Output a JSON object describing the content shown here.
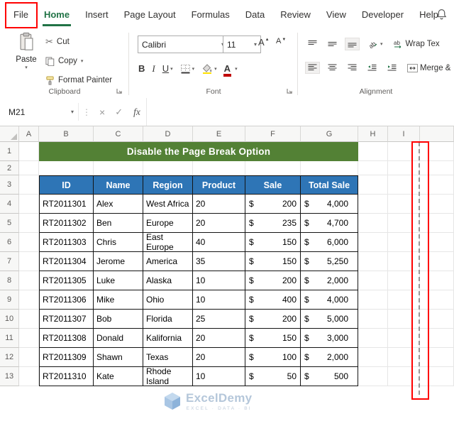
{
  "colors": {
    "accent_green": "#217346",
    "banner_green": "#538135",
    "table_header_blue": "#2E75B6",
    "annotation_red": "#FF0000"
  },
  "icons": {
    "cut": "✂",
    "dropdown": "▾",
    "cancel": "×",
    "enter": "✓",
    "separator": "⋮",
    "increase_letter": "A",
    "decrease_letter": "A",
    "up_tiny": "▲",
    "down_tiny": "▼"
  },
  "ribbon": {
    "tabs": [
      {
        "label": "File"
      },
      {
        "label": "Home"
      },
      {
        "label": "Insert"
      },
      {
        "label": "Page Layout"
      },
      {
        "label": "Formulas"
      },
      {
        "label": "Data"
      },
      {
        "label": "Review"
      },
      {
        "label": "View"
      },
      {
        "label": "Developer"
      },
      {
        "label": "Help"
      }
    ],
    "active_tab": "Home",
    "highlighted_tab": "File",
    "clipboard": {
      "group_label": "Clipboard",
      "paste": "Paste",
      "cut": "Cut",
      "copy": "Copy",
      "format_painter": "Format Painter"
    },
    "font": {
      "group_label": "Font",
      "font_name": "Calibri",
      "font_size": "11",
      "bold": "B",
      "italic": "I",
      "underline": "U",
      "font_color_letter": "A"
    },
    "alignment": {
      "group_label": "Alignment",
      "orientation_ab": "ab",
      "wrap_ab": "ab",
      "wrap_text": "Wrap Tex",
      "merge": "Merge &"
    }
  },
  "formula_bar": {
    "name_box": "M21",
    "fx_label": "fx",
    "formula_value": ""
  },
  "grid": {
    "column_headers": [
      "A",
      "B",
      "C",
      "D",
      "E",
      "F",
      "G",
      "H",
      "I"
    ],
    "row_headers": [
      "1",
      "2",
      "3",
      "4",
      "5",
      "6",
      "7",
      "8",
      "9",
      "10",
      "11",
      "12",
      "13"
    ],
    "banner_text": "Disable the Page Break Option",
    "table_headers": [
      "ID",
      "Name",
      "Region",
      "Product",
      "Sale",
      "Total Sale"
    ],
    "table_rows": [
      {
        "id": "RT2011301",
        "name": "Alex",
        "region": "West Africa",
        "product": "20",
        "sale_cur": "$",
        "sale": "200",
        "total_cur": "$",
        "total": "4,000"
      },
      {
        "id": "RT2011302",
        "name": "Ben",
        "region": "Europe",
        "product": "20",
        "sale_cur": "$",
        "sale": "235",
        "total_cur": "$",
        "total": "4,700"
      },
      {
        "id": "RT2011303",
        "name": "Chris",
        "region": "East Europe",
        "product": "40",
        "sale_cur": "$",
        "sale": "150",
        "total_cur": "$",
        "total": "6,000"
      },
      {
        "id": "RT2011304",
        "name": "Jerome",
        "region": "America",
        "product": "35",
        "sale_cur": "$",
        "sale": "150",
        "total_cur": "$",
        "total": "5,250"
      },
      {
        "id": "RT2011305",
        "name": "Luke",
        "region": "Alaska",
        "product": "10",
        "sale_cur": "$",
        "sale": "200",
        "total_cur": "$",
        "total": "2,000"
      },
      {
        "id": "RT2011306",
        "name": "Mike",
        "region": "Ohio",
        "product": "10",
        "sale_cur": "$",
        "sale": "400",
        "total_cur": "$",
        "total": "4,000"
      },
      {
        "id": "RT2011307",
        "name": "Bob",
        "region": "Florida",
        "product": "25",
        "sale_cur": "$",
        "sale": "200",
        "total_cur": "$",
        "total": "5,000"
      },
      {
        "id": "RT2011308",
        "name": "Donald",
        "region": "Kalifornia",
        "product": "20",
        "sale_cur": "$",
        "sale": "150",
        "total_cur": "$",
        "total": "3,000"
      },
      {
        "id": "RT2011309",
        "name": "Shawn",
        "region": "Texas",
        "product": "20",
        "sale_cur": "$",
        "sale": "100",
        "total_cur": "$",
        "total": "2,000"
      },
      {
        "id": "RT2011310",
        "name": "Kate",
        "region": "Rhode Island",
        "product": "10",
        "sale_cur": "$",
        "sale": "50",
        "total_cur": "$",
        "total": "500"
      }
    ]
  },
  "watermark": {
    "brand": "ExcelDemy",
    "tagline": "EXCEL · DATA · BI"
  }
}
